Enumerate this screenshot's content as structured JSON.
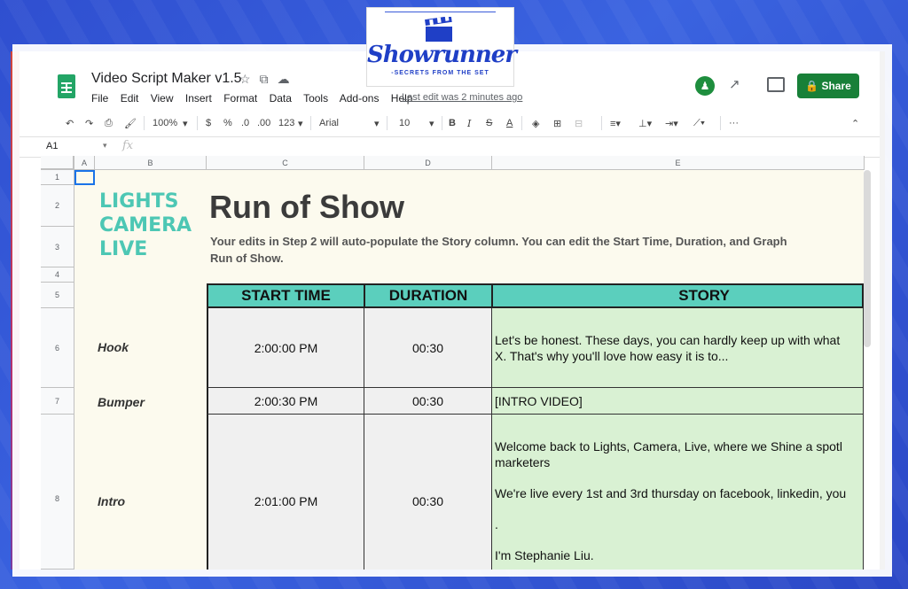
{
  "logo": {
    "word": "Showrunner",
    "tagline": "-SECRETS FROM THE SET"
  },
  "doc": {
    "title": "Video Script Maker v1.5",
    "menus": [
      "File",
      "Edit",
      "View",
      "Insert",
      "Format",
      "Data",
      "Tools",
      "Add-ons",
      "Help"
    ],
    "last_edit": "Last edit was 2 minutes ago",
    "share_label": "Share"
  },
  "toolbar": {
    "zoom": "100%",
    "currency": "$",
    "percent": "%",
    "dec_less": ".0",
    "dec_more": ".00",
    "format_more": "123",
    "font": "Arial",
    "font_size": "10"
  },
  "formula": {
    "cell_ref": "A1",
    "fx": "fx"
  },
  "columns": [
    "A",
    "B",
    "C",
    "D",
    "E"
  ],
  "rows": [
    "1",
    "2",
    "3",
    "4",
    "5",
    "6",
    "7",
    "8"
  ],
  "sheet": {
    "brand": [
      "LIGHTS",
      "CAMERA",
      "LIVE"
    ],
    "title": "Run of Show",
    "subtitle_1": "Your edits in Step 2 will auto-populate the Story column. You can edit the Start Time, Duration, and Graph",
    "subtitle_2": "Run of Show.",
    "headers": {
      "start": "START TIME",
      "duration": "DURATION",
      "story": "STORY"
    },
    "segments": [
      {
        "label": "Hook",
        "start": "2:00:00 PM",
        "duration": "00:30",
        "story": [
          "Let's be honest. These days, you can hardly keep up with what",
          "X. That's why you'll love how easy it is to..."
        ]
      },
      {
        "label": "Bumper",
        "start": "2:00:30 PM",
        "duration": "00:30",
        "story": [
          "[INTRO VIDEO]"
        ]
      },
      {
        "label": "Intro",
        "start": "2:01:00 PM",
        "duration": "00:30",
        "story": [
          "Welcome back to Lights, Camera, Live, where we Shine a spotl",
          "marketers",
          "We're live every 1st and 3rd thursday on facebook, linkedin, you",
          ".",
          "I'm Stephanie Liu."
        ]
      }
    ]
  }
}
